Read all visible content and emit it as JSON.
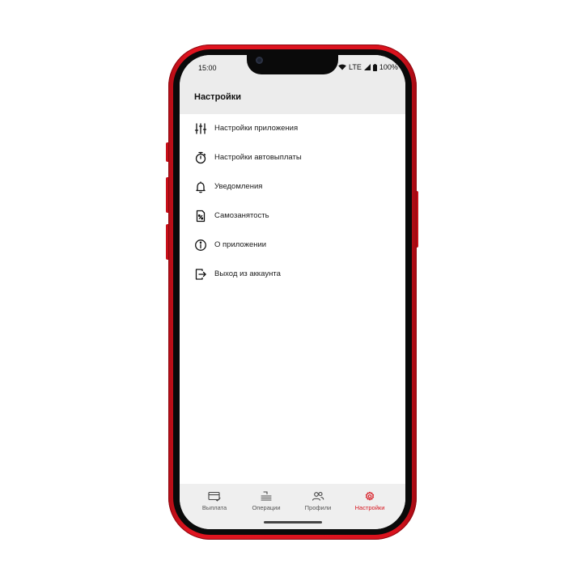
{
  "status_bar": {
    "time": "15:00",
    "network": "LTE",
    "battery": "100%"
  },
  "header": {
    "title": "Настройки"
  },
  "menu": {
    "items": [
      {
        "label": "Настройки приложения",
        "icon": "sliders-icon"
      },
      {
        "label": "Настройки автовыплаты",
        "icon": "stopwatch-icon"
      },
      {
        "label": "Уведомления",
        "icon": "bell-icon"
      },
      {
        "label": "Самозанятость",
        "icon": "document-percent-icon"
      },
      {
        "label": "О приложении",
        "icon": "info-icon"
      },
      {
        "label": "Выход из аккаунта",
        "icon": "logout-icon"
      }
    ]
  },
  "tabbar": {
    "tabs": [
      {
        "label": "Выплата",
        "icon": "card-check-icon",
        "active": false
      },
      {
        "label": "Операции",
        "icon": "operations-icon",
        "active": false
      },
      {
        "label": "Профили",
        "icon": "profiles-icon",
        "active": false
      },
      {
        "label": "Настройки",
        "icon": "gear-icon",
        "active": true
      }
    ]
  },
  "colors": {
    "accent": "#d7161f",
    "phone_frame": "#d9121d",
    "header_bg": "#ececec",
    "tabbar_bg": "#efefef"
  }
}
